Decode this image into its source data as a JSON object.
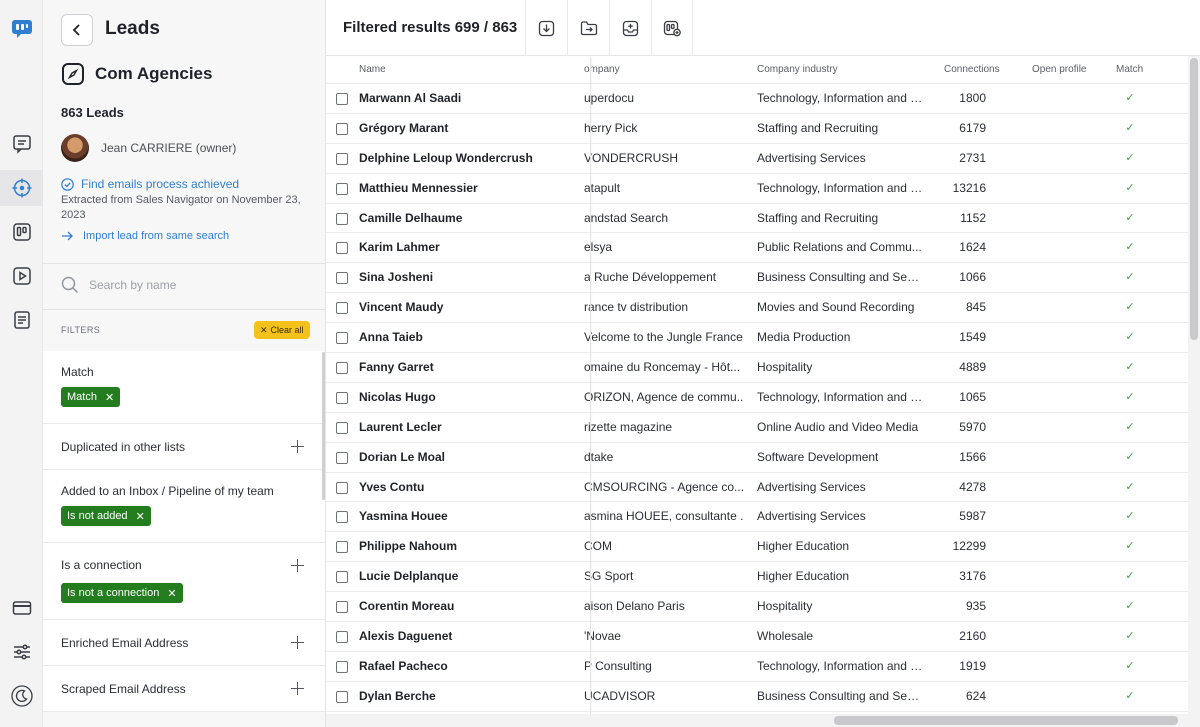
{
  "sidebar": {
    "back_label": "",
    "title": "Leads",
    "list_name": "Com Agencies",
    "leads_count": "863 Leads",
    "owner": "Jean CARRIERE (owner)",
    "find_emails": "Find emails process achieved",
    "extracted": "Extracted from Sales Navigator on November 23, 2023",
    "import_link": "Import lead from same search",
    "search_placeholder": "Search by name",
    "filters_label": "FILTERS",
    "clear_all": "Clear all",
    "filters": [
      {
        "title": "Match",
        "chip": "Match"
      },
      {
        "title": "Duplicated in other lists",
        "chip": ""
      },
      {
        "title": "Added to an Inbox / Pipeline of my team",
        "chip": "Is not added"
      },
      {
        "title": "Is a connection",
        "chip": "Is not a connection"
      },
      {
        "title": "Enriched Email Address",
        "chip": ""
      },
      {
        "title": "Scraped Email Address",
        "chip": ""
      }
    ]
  },
  "toolbar": {
    "filtered_results": "Filtered results 699 / 863",
    "buttons": [
      "download-icon",
      "export-icon",
      "add-to-inbox-icon",
      "enrich-icon"
    ]
  },
  "table": {
    "headers": {
      "name": "Name",
      "company": "ompany",
      "industry": "Company industry",
      "connections": "Connections",
      "open_profile": "Open profile",
      "match": "Match"
    },
    "rows": [
      {
        "name": "Marwann Al Saadi",
        "company": "uperdocu",
        "industry": "Technology, Information and I...",
        "connections": "1800",
        "match": "✓"
      },
      {
        "name": "Grégory Marant",
        "company": "herry Pick",
        "industry": "Staffing and Recruiting",
        "connections": "6179",
        "match": "✓"
      },
      {
        "name": "Delphine Leloup Wondercrush",
        "company": "VONDERCRUSH",
        "industry": "Advertising Services",
        "connections": "2731",
        "match": "✓"
      },
      {
        "name": "Matthieu Mennessier",
        "company": "atapult",
        "industry": "Technology, Information and I...",
        "connections": "13216",
        "match": "✓"
      },
      {
        "name": "Camille Delhaume",
        "company": "andstad Search",
        "industry": "Staffing and Recruiting",
        "connections": "1152",
        "match": "✓"
      },
      {
        "name": "Karim Lahmer",
        "company": "elsya",
        "industry": "Public Relations and Commu...",
        "connections": "1624",
        "match": "✓"
      },
      {
        "name": "Sina Josheni",
        "company": "a Ruche Développement",
        "industry": "Business Consulting and Serv...",
        "connections": "1066",
        "match": "✓"
      },
      {
        "name": "Vincent Maudy",
        "company": "rance tv distribution",
        "industry": "Movies and Sound Recording",
        "connections": "845",
        "match": "✓"
      },
      {
        "name": "Anna Taieb",
        "company": "Velcome to the Jungle France",
        "industry": "Media Production",
        "connections": "1549",
        "match": "✓"
      },
      {
        "name": "Fanny Garret",
        "company": "omaine du Roncemay - Hôt...",
        "industry": "Hospitality",
        "connections": "4889",
        "match": "✓"
      },
      {
        "name": "Nicolas Hugo",
        "company": "ORIZON, Agence de commu...",
        "industry": "Technology, Information and I...",
        "connections": "1065",
        "match": "✓"
      },
      {
        "name": "Laurent Lecler",
        "company": "rizette magazine",
        "industry": "Online Audio and Video Media",
        "connections": "5970",
        "match": "✓"
      },
      {
        "name": "Dorian Le Moal",
        "company": "dtake",
        "industry": "Software Development",
        "connections": "1566",
        "match": "✓"
      },
      {
        "name": "Yves Contu",
        "company": "CMSOURCING - Agence co...",
        "industry": "Advertising Services",
        "connections": "4278",
        "match": "✓"
      },
      {
        "name": "Yasmina Houee",
        "company": "asmina HOUEE, consultante ...",
        "industry": "Advertising Services",
        "connections": "5987",
        "match": "✓"
      },
      {
        "name": "Philippe Nahoum",
        "company": "COM",
        "industry": "Higher Education",
        "connections": "12299",
        "match": "✓"
      },
      {
        "name": "Lucie Delplanque",
        "company": "SG Sport",
        "industry": "Higher Education",
        "connections": "3176",
        "match": "✓"
      },
      {
        "name": "Corentin Moreau",
        "company": "aison Delano Paris",
        "industry": "Hospitality",
        "connections": "935",
        "match": "✓"
      },
      {
        "name": "Alexis Daguenet",
        "company": "'Novae",
        "industry": "Wholesale",
        "connections": "2160",
        "match": "✓"
      },
      {
        "name": "Rafael Pacheco",
        "company": "P Consulting",
        "industry": "Technology, Information and I...",
        "connections": "1919",
        "match": "✓"
      },
      {
        "name": "Dylan Berche",
        "company": "UCADVISOR",
        "industry": "Business Consulting and Serv...",
        "connections": "624",
        "match": "✓"
      }
    ]
  },
  "colors": {
    "brand": "#2f7fd1",
    "chip_green": "#237d1e",
    "clear_all_yellow": "#f5c21b",
    "match_check": "#3aa043"
  }
}
